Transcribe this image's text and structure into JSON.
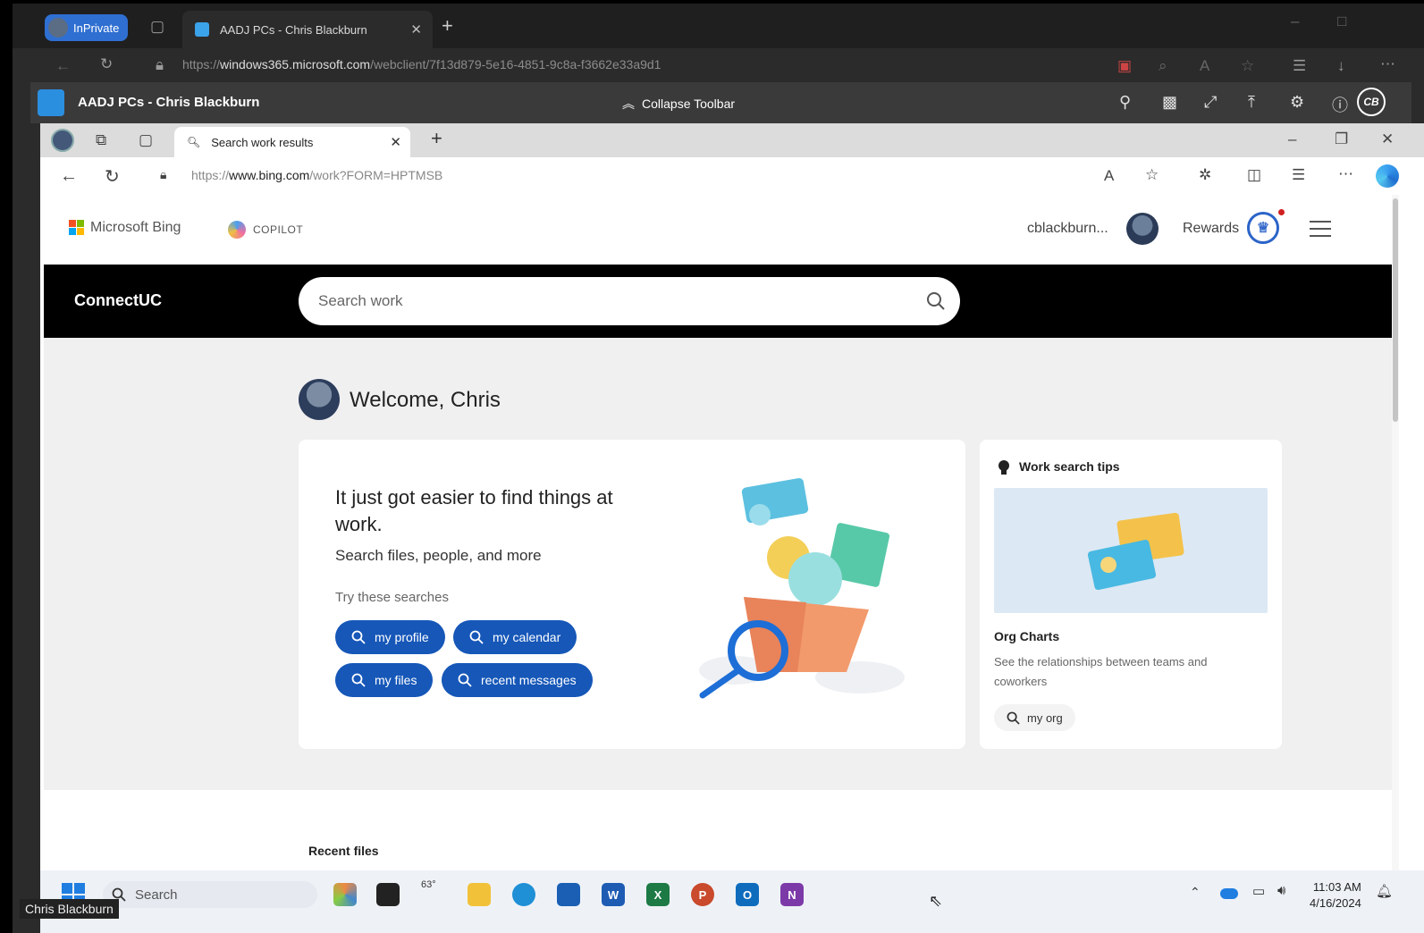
{
  "outer_browser": {
    "inprivate_label": "InPrivate",
    "tab_title": "AADJ PCs - Chris Blackburn",
    "url_prefix": "https://",
    "url_domain": "windows365.microsoft.com",
    "url_path": "/webclient/7f13d879-5e16-4851-9c8a-f3662e33a9d1"
  },
  "w365_toolbar": {
    "title": "AADJ PCs - Chris Blackburn",
    "collapse_label": "Collapse Toolbar",
    "user_initials": "CB"
  },
  "inner_browser": {
    "tab_title": "Search work results",
    "url_prefix": "https://",
    "url_domain": "www.bing.com",
    "url_path": "/work?FORM=HPTMSB"
  },
  "bing_header": {
    "brand": "Microsoft Bing",
    "copilot": "COPILOT",
    "username": "cblackburn...",
    "rewards": "Rewards"
  },
  "connectuc": {
    "title": "ConnectUC",
    "search_placeholder": "Search work"
  },
  "welcome": {
    "text": "Welcome, Chris"
  },
  "main_card": {
    "headline": "It just got easier to find things at work.",
    "subline": "Search files, people, and more",
    "try_label": "Try these searches",
    "pills": [
      "my profile",
      "my calendar",
      "my files",
      "recent messages"
    ]
  },
  "tips_card": {
    "title": "Work search tips",
    "org_title": "Org Charts",
    "org_desc": "See the relationships between teams and coworkers",
    "org_button": "my org"
  },
  "recent_files_label": "Recent files",
  "taskbar": {
    "search_label": "Search",
    "weather": "63°",
    "time": "11:03 AM",
    "date": "4/16/2024"
  },
  "overlay_name": "Chris Blackburn",
  "colors": {
    "accent": "#1657b8",
    "connectuc_band": "#000000",
    "page_bg": "#f1f0f1"
  }
}
